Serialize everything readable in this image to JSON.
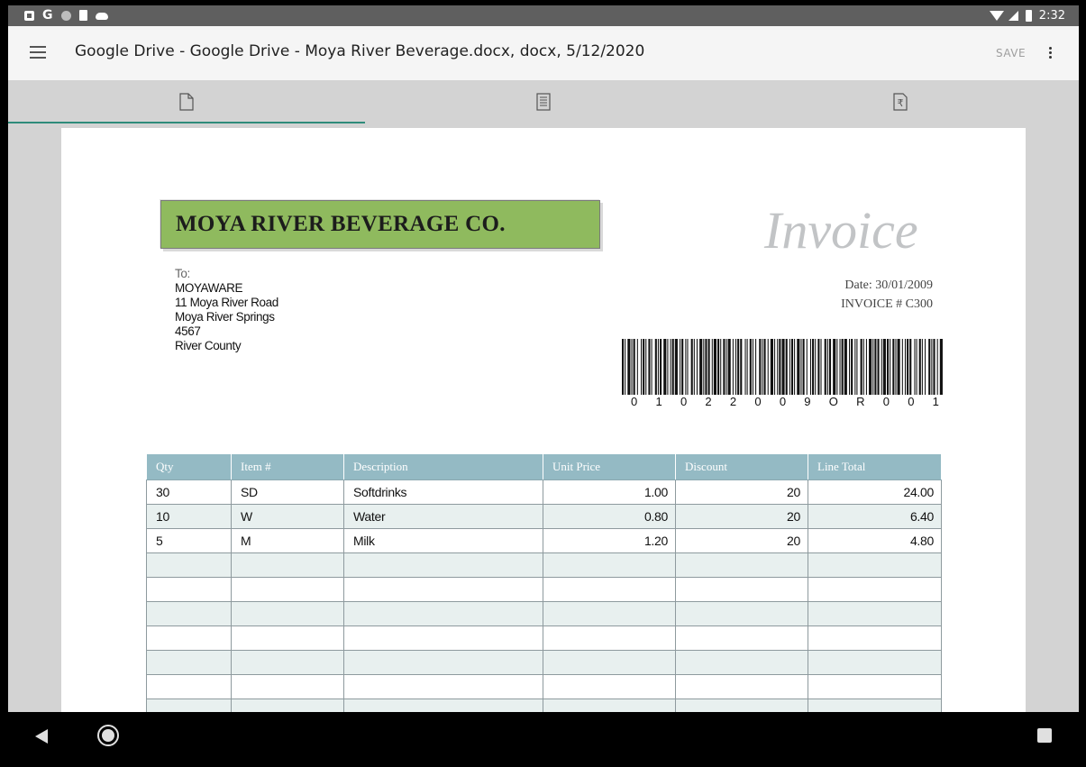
{
  "status_bar": {
    "left_icons": [
      "notification-a-icon",
      "google-icon",
      "circle-icon",
      "sd-card-icon",
      "cloud-icon"
    ],
    "google_glyph": "G",
    "right_icons": [
      "wifi-icon",
      "signal-icon",
      "battery-icon"
    ],
    "time": "2:32"
  },
  "app_bar": {
    "menu_icon": "hamburger-menu-icon",
    "title": "Google Drive - Google Drive - Moya River Beverage.docx, docx, 5/12/2020",
    "save_label": "SAVE",
    "more_icon": "more-vert-icon"
  },
  "tabs": [
    {
      "icon": "document-icon",
      "active": true
    },
    {
      "icon": "form-icon",
      "active": false
    },
    {
      "icon": "rupee-document-icon",
      "active": false
    }
  ],
  "invoice": {
    "company": "MOYA RIVER BEVERAGE CO.",
    "heading": "Invoice",
    "to_label": "To:",
    "address": [
      "MOYAWARE",
      "11 Moya River Road",
      "Moya River Springs",
      "4567",
      "River County"
    ],
    "date_line": "Date: 30/01/2009",
    "invoice_line": "INVOICE # C300",
    "barcode_chars": [
      "0",
      "1",
      "0",
      "2",
      "2",
      "0",
      "0",
      "9",
      "O",
      "R",
      "0",
      "0",
      "1"
    ],
    "columns": [
      "Qty",
      "Item #",
      "Description",
      "Unit Price",
      "Discount",
      "Line Total"
    ],
    "rows": [
      [
        "30",
        "SD",
        "Softdrinks",
        "1.00",
        "20",
        "24.00"
      ],
      [
        "10",
        "W",
        "Water",
        "0.80",
        "20",
        "6.40"
      ],
      [
        "5",
        "M",
        "Milk",
        "1.20",
        "20",
        "4.80"
      ]
    ],
    "empty_rows": 7
  },
  "nav_bar": {
    "icons": [
      "back-icon",
      "home-icon",
      "recents-icon"
    ]
  },
  "colors": {
    "logo_green": "#8fba5e",
    "table_header": "#94bac4",
    "tab_indicator": "#2e8b7a",
    "row_stripe": "#e8f0ef"
  }
}
